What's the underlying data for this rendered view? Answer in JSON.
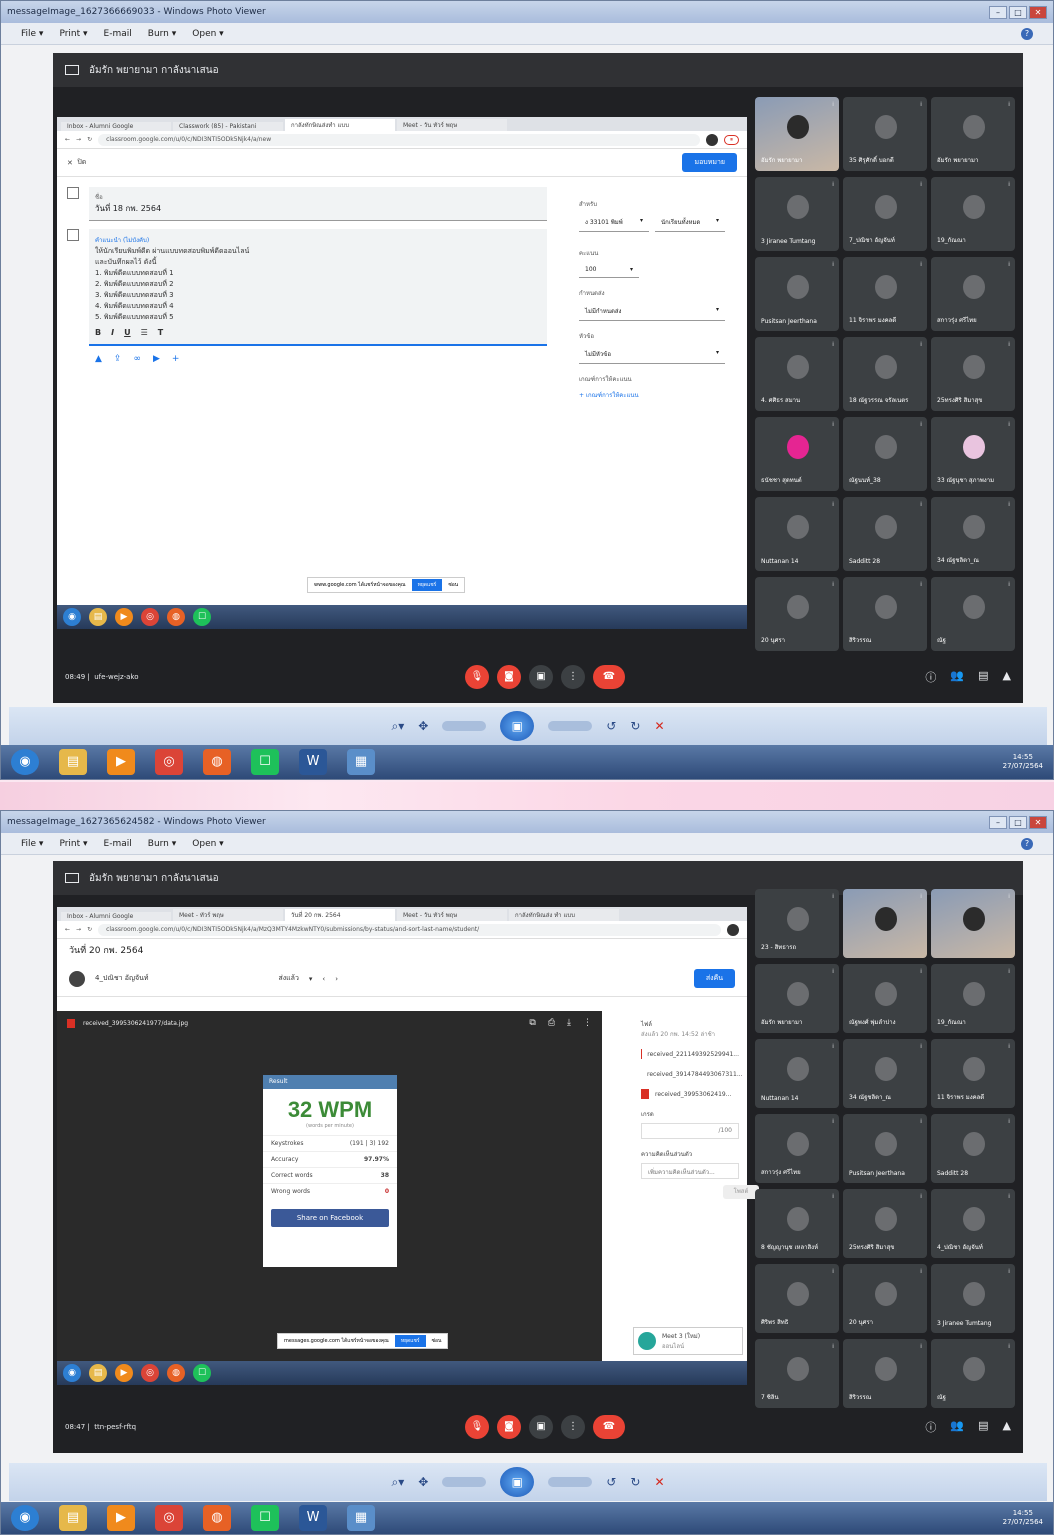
{
  "shot1": {
    "window_title": "messageImage_1627366669033 - Windows Photo Viewer",
    "menu": [
      "File ▾",
      "Print ▾",
      "E-mail",
      "Burn ▾",
      "Open ▾"
    ],
    "meet_title": "อัมรัก พยายามา กาลังนาเสนอ",
    "tabs": [
      "Inbox - Alumni Google",
      "Classwork (85) - Pakistani",
      "กาลังทักษิณส่งทำ แบบ",
      "Meet - วัน ทัวร์ พฤษ"
    ],
    "url": "classroom.google.com/u/0/c/NDI3NTI5ODk5Njk4/a/new",
    "assign_button": "มอบหมาย",
    "close_label": "ปิด",
    "title_label": "ชื่อ",
    "title_value": "วันที่ 18 กพ. 2564",
    "instructions_label": "คำแนะนำ (ไม่บังคับ)",
    "instructions": [
      "ให้นักเรียนพิมพ์ดีด ผ่านแบบทดสอบพิมพ์ดีดออนไลน์",
      "และบันทึกผลไว้ ดังนี้",
      "1. พิมพ์ดีดแบบทดสอบที่ 1",
      "2. พิมพ์ดีดแบบทดสอบที่ 2",
      "3. พิมพ์ดีดแบบทดสอบที่ 3",
      "4. พิมพ์ดีดแบบทดสอบที่ 4",
      "5. พิมพ์ดีดแบบทดสอบที่ 5"
    ],
    "side": {
      "for_label": "สำหรับ",
      "for_class": "ง 33101 พิมพ์",
      "for_students": "นักเรียนทั้งหมด",
      "points_label": "คะแนน",
      "points": "100",
      "due_label": "กำหนดส่ง",
      "due_value": "ไม่มีกำหนดส่ง",
      "topic_label": "หัวข้อ",
      "topic_value": "ไม่มีหัวข้อ",
      "rubric_label": "เกณฑ์การให้คะแนน",
      "rubric_link": "+ เกณฑ์การให้คะแนน"
    },
    "download_text": "www.google.com ได้แชร์หน้าจอของคุณ",
    "download_button": "หยุดแชร์",
    "download_hide": "ซ่อน",
    "meeting_time": "08:49",
    "meeting_code": "ufe-wejz-ako",
    "participants": [
      {
        "name": "อัมรัก พยายามา",
        "kind": "video"
      },
      {
        "name": "35 ศิรุศักดิ์ บอกดี",
        "kind": "avatar"
      },
      {
        "name": "อัมรัก พยายามา",
        "kind": "avatar"
      },
      {
        "name": "3 Jiranee Tumtang",
        "kind": "avatar"
      },
      {
        "name": "7_ปณิชา อัญจันท์",
        "kind": "avatar"
      },
      {
        "name": "19_กัณณา",
        "kind": "avatar"
      },
      {
        "name": "Pusitsan Jeerthana",
        "kind": "avatar"
      },
      {
        "name": "11 จิราพร มงคลดี",
        "kind": "avatar"
      },
      {
        "name": "สกาวรุ่ง ศรีไทย",
        "kind": "avatar"
      },
      {
        "name": "4. ศศิธร สมาน",
        "kind": "avatar"
      },
      {
        "name": "18 ณัฐวรรณ จรัลเนตร",
        "kind": "avatar"
      },
      {
        "name": "25ทรงศิริ สิมาสุข",
        "kind": "avatar"
      },
      {
        "name": "ธนัชชา สุดทนต์",
        "kind": "pink"
      },
      {
        "name": "ณัฐนนท์_38",
        "kind": "avatar"
      },
      {
        "name": "33 ณัฐนุชา สุภาพงาม",
        "kind": "lilac"
      },
      {
        "name": "Nuttanan 14",
        "kind": "avatar"
      },
      {
        "name": "Sadditt 28",
        "kind": "avatar"
      },
      {
        "name": "34 ณัฐชลิตา_ณ",
        "kind": "avatar"
      },
      {
        "name": "20 นุศรา",
        "kind": "avatar"
      },
      {
        "name": "สิริวรรณ",
        "kind": "avatar"
      },
      {
        "name": "ณัฐ",
        "kind": "avatar"
      }
    ],
    "clock_time": "14:55",
    "clock_date": "27/07/2564"
  },
  "shot2": {
    "window_title": "messageImage_1627365624582 - Windows Photo Viewer",
    "menu": [
      "File ▾",
      "Print ▾",
      "E-mail",
      "Burn ▾",
      "Open ▾"
    ],
    "meet_title": "อัมรัก พยายามา กาลังนาเสนอ",
    "tabs": [
      "Inbox - Alumni Google",
      "Meet - ทัวร์ พฤษ",
      "วันที่ 20 กพ. 2564",
      "Meet - วัน ทัวร์ พฤษ",
      "กาลังทักษิณส่ง ทำ แบบ"
    ],
    "url": "classroom.google.com/u/0/c/NDI3NTI5ODk5Njk4/a/MzQ3MTY4MzkwNTY0/submissions/by-status/and-sort-last-name/student/",
    "page_title": "วันที่ 20 กพ. 2564",
    "student_name": "4_ปณิชา อัญจันท์",
    "student_status": "ส่งแล้ว",
    "return_button": "ส่งคืน",
    "pdf_name": "received_3995306241977/data.jpg",
    "result_card": {
      "header": "Result",
      "wpm": "32 WPM",
      "sub": "(words per minute)",
      "rows": [
        {
          "label": "Keystrokes",
          "value": "(191 | 3) 192"
        },
        {
          "label": "Accuracy",
          "value": "97.97%"
        },
        {
          "label": "Correct words",
          "value": "38"
        },
        {
          "label": "Wrong words",
          "value": "0"
        }
      ],
      "share": "Share on Facebook"
    },
    "files_label": "ไฟล์",
    "files_meta": "ส่งแล้ว 20 กพ. 14:52 ล่าช้า",
    "files": [
      "received_221149392529941...",
      "received_3914784493067311...",
      "received_39953062419..."
    ],
    "grade_label": "เกรด",
    "grade_value": "/100",
    "comment_label": "ความคิดเห็นส่วนตัว",
    "comment_placeholder": "เพิ่มความคิดเห็นส่วนตัว...",
    "post_button": "โพสต์",
    "notif_title": "Meet 3 (ใหม่)",
    "notif_sub": "ออนไลน์",
    "download_text": "messages.google.com ได้แชร์หน้าจอของคุณ",
    "download_button": "หยุดแชร์",
    "download_hide": "ซ่อน",
    "meeting_time": "08:47",
    "meeting_code": "ttn-pesf-rftq",
    "participants": [
      {
        "name": "23 - สิทธารถ",
        "kind": "avatar"
      },
      {
        "name": "",
        "kind": "video"
      },
      {
        "name": "",
        "kind": "video"
      },
      {
        "name": "อัมรัก พยายามา",
        "kind": "avatar"
      },
      {
        "name": "ณัฐพงศ์ พุ่มลำปาง",
        "kind": "avatar"
      },
      {
        "name": "19_กัณณา",
        "kind": "avatar"
      },
      {
        "name": "Nuttanan 14",
        "kind": "avatar"
      },
      {
        "name": "34 ณัฐชลิตา_ณ",
        "kind": "avatar"
      },
      {
        "name": "11 จิราพร มงคลดี",
        "kind": "avatar"
      },
      {
        "name": "สกาวรุ่ง ศรีไทย",
        "kind": "avatar"
      },
      {
        "name": "Pusitsan Jeerthana",
        "kind": "avatar"
      },
      {
        "name": "Sadditt 28",
        "kind": "avatar"
      },
      {
        "name": "8 ชัญญานุช เหลาสิงห์",
        "kind": "avatar"
      },
      {
        "name": "25ทรงศิริ สิมาสุข",
        "kind": "avatar"
      },
      {
        "name": "4_ปณิชา อัญจันท์",
        "kind": "avatar"
      },
      {
        "name": "ศิริพร สิทธิ",
        "kind": "avatar"
      },
      {
        "name": "20 นุศรา",
        "kind": "avatar"
      },
      {
        "name": "3 Jiranee Tumtang",
        "kind": "avatar"
      },
      {
        "name": "7 ซิลิน",
        "kind": "avatar"
      },
      {
        "name": "สิริวรรณ",
        "kind": "avatar"
      },
      {
        "name": "ณัฐ",
        "kind": "avatar"
      }
    ],
    "clock_time": "14:55",
    "clock_date": "27/07/2564"
  },
  "colors": {
    "meet_bg": "#202124",
    "tile_bg": "#3c4043",
    "google_blue": "#1a73e8",
    "end_call_red": "#ea4335",
    "wpm_green": "#3c8b37",
    "facebook_blue": "#3b5998"
  },
  "icons": [
    "present-icon",
    "mic-off-icon",
    "camera-off-icon",
    "captions-icon",
    "more-icon",
    "end-call-icon",
    "info-icon",
    "people-icon",
    "chat-icon",
    "activities-icon",
    "zoom-icon",
    "rotate-icon",
    "delete-icon",
    "play-slideshow-icon"
  ]
}
